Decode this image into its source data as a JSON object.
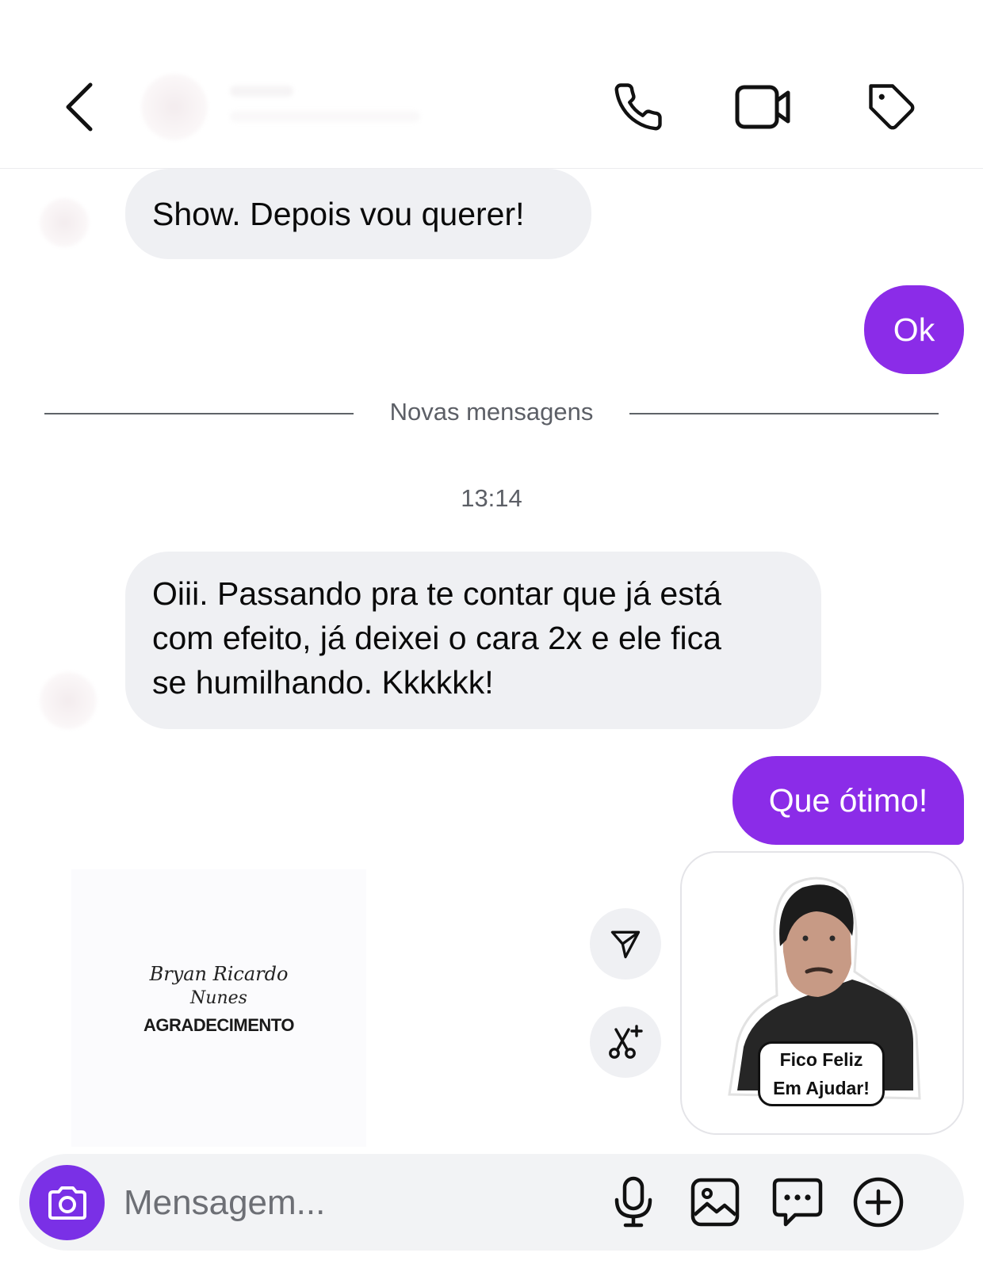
{
  "header": {
    "back_icon": "chevron-left-icon",
    "call_icon": "phone-icon",
    "video_icon": "video-camera-icon",
    "tag_icon": "tag-icon"
  },
  "messages": {
    "msg1": "Show. Depois vou querer!",
    "msg2": "Ok",
    "divider": "Novas mensagens",
    "timestamp": "13:14",
    "msg3_lines": [
      "Oiii. Passando pra te contar que já está",
      "com efeito, já deixei o cara 2x e ele fica",
      "se humilhando. Kkkkkk!"
    ],
    "msg4": "Que ótimo!"
  },
  "card": {
    "signature_line1": "Bryan Ricardo",
    "signature_line2": "Nunes",
    "caption": "AGRADECIMENTO"
  },
  "sticker": {
    "caption_line1": "Fico Feliz",
    "caption_line2": "Em Ajudar!"
  },
  "composer": {
    "placeholder": "Mensagem...",
    "icons": [
      "camera-icon",
      "microphone-icon",
      "image-icon",
      "chat-bubble-icon",
      "plus-circle-icon"
    ]
  },
  "colors": {
    "outgoing_bubble": "#8b2ce8",
    "incoming_bubble": "#eff0f3",
    "camera_button": "#7a30e6"
  }
}
